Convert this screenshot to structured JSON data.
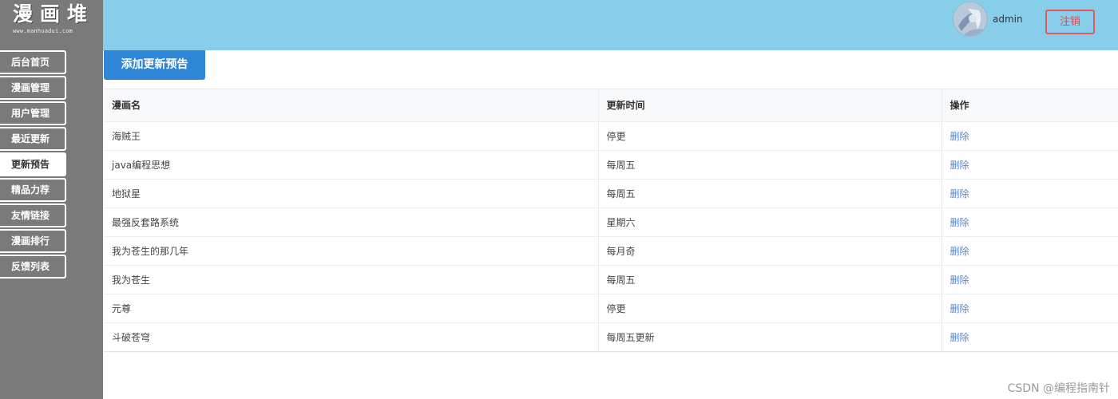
{
  "logo": {
    "title": "漫画堆",
    "subtitle": "www.manhuadui.com"
  },
  "sidebar": {
    "items": [
      {
        "label": "后台首页",
        "active": false
      },
      {
        "label": "漫画管理",
        "active": false
      },
      {
        "label": "用户管理",
        "active": false
      },
      {
        "label": "最近更新",
        "active": false
      },
      {
        "label": "更新预告",
        "active": true
      },
      {
        "label": "精品力荐",
        "active": false
      },
      {
        "label": "友情链接",
        "active": false
      },
      {
        "label": "漫画排行",
        "active": false
      },
      {
        "label": "反馈列表",
        "active": false
      }
    ]
  },
  "header": {
    "username": "admin",
    "logout_label": "注销"
  },
  "main": {
    "add_button_label": "添加更新预告",
    "table": {
      "headers": [
        "漫画名",
        "更新时间",
        "操作"
      ],
      "rows": [
        {
          "name": "海贼王",
          "time": "停更",
          "action": "删除"
        },
        {
          "name": "java编程思想",
          "time": "每周五",
          "action": "删除"
        },
        {
          "name": "地狱星",
          "time": "每周五",
          "action": "删除"
        },
        {
          "name": "最强反套路系统",
          "time": "星期六",
          "action": "删除"
        },
        {
          "name": "我为苍生的那几年",
          "time": "每月奇",
          "action": "删除"
        },
        {
          "name": "我为苍生",
          "time": "每周五",
          "action": "删除"
        },
        {
          "name": "元尊",
          "time": "停更",
          "action": "删除"
        },
        {
          "name": "斗破苍穹",
          "time": "每周五更新",
          "action": "删除"
        }
      ]
    }
  },
  "watermark": "CSDN @编程指南针",
  "colors": {
    "sidebar_bg": "#7a7a7a",
    "header_bg": "#87ceeb",
    "primary_button": "#2f86d6",
    "logout_border": "#e05a5a",
    "link": "#5a86c8"
  },
  "icons": {
    "avatar": "user-avatar-image"
  }
}
